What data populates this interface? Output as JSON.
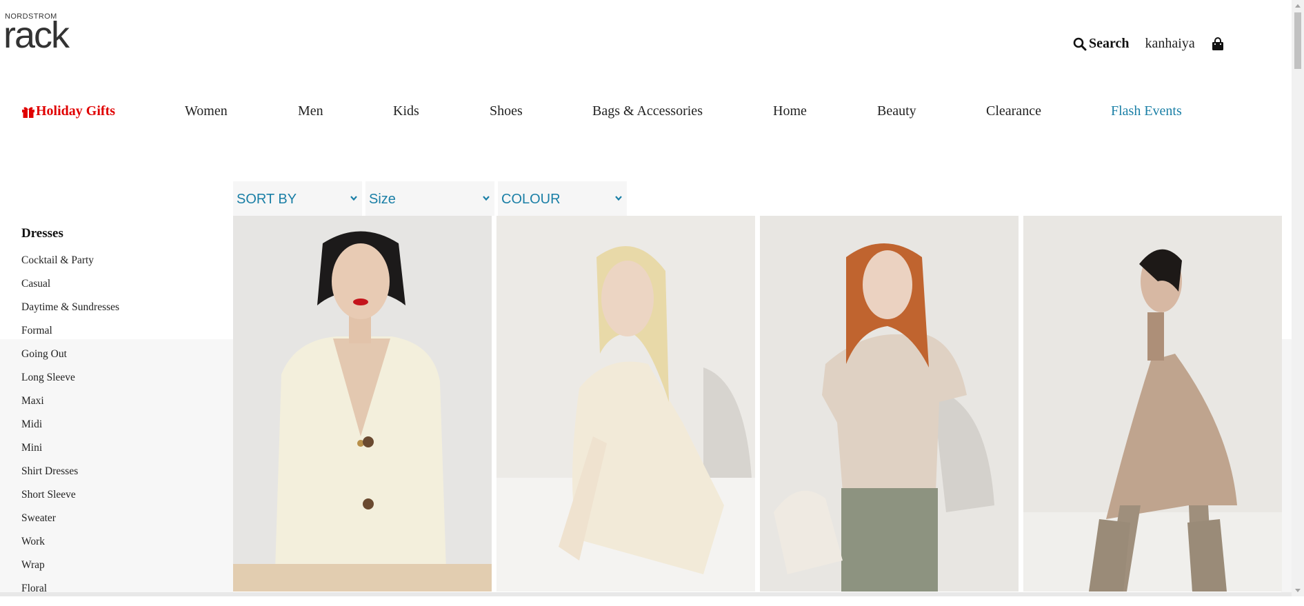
{
  "header": {
    "logo_small": "NORDSTROM",
    "logo_big": "rack",
    "search_label": "Search",
    "account_name": "kanhaiya"
  },
  "nav": {
    "items": [
      "Holiday Gifts",
      "Women",
      "Men",
      "Kids",
      "Shoes",
      "Bags & Accessories",
      "Home",
      "Beauty",
      "Clearance",
      "Flash Events"
    ]
  },
  "filters": {
    "sort_label": "SORT BY",
    "size_label": "Size",
    "colour_label": "COLOUR"
  },
  "sidebar": {
    "title": "Dresses",
    "items": [
      "Cocktail & Party",
      "Casual",
      "Daytime & Sundresses",
      "Formal",
      "Going Out",
      "Long Sleeve",
      "Maxi",
      "Midi",
      "Mini",
      "Shirt Dresses",
      "Short Sleeve",
      "Sweater",
      "Work",
      "Wrap",
      "Floral"
    ]
  },
  "colors": {
    "holiday_red": "#e00000",
    "accent_teal": "#1a7fa6",
    "filter_bg": "#f6f6f6"
  }
}
